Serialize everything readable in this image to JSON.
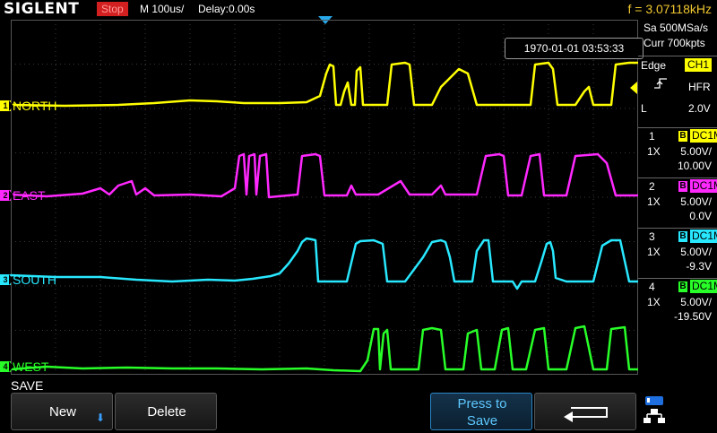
{
  "header": {
    "brand": "SIGLENT",
    "run_state": "Stop",
    "timebase": "M 100us/",
    "delay": "Delay:0.00s",
    "frequency": "f = 3.07118kHz"
  },
  "timestamp": "1970-01-01 03:53:33",
  "acquisition": {
    "sample_rate": "Sa 500MSa/s",
    "memory_depth": "Curr 700kpts"
  },
  "trigger": {
    "type": "Edge",
    "source": "CH1",
    "slope_icon": "rising-edge-icon",
    "coupling": "HFR",
    "level_label": "L",
    "level": "2.0V"
  },
  "channels": [
    {
      "num": "1",
      "bw": "B",
      "coupling": "DC1M",
      "probe": "1X",
      "scale": "5.00V/",
      "offset": "10.00V",
      "label": "NORTH",
      "color": "#ffff00"
    },
    {
      "num": "2",
      "bw": "B",
      "coupling": "DC1M",
      "probe": "1X",
      "scale": "5.00V/",
      "offset": "0.0V",
      "label": "EAST",
      "color": "#ff28ff"
    },
    {
      "num": "3",
      "bw": "B",
      "coupling": "DC1M",
      "probe": "1X",
      "scale": "5.00V/",
      "offset": "-9.3V",
      "label": "SOUTH",
      "color": "#28e8ff"
    },
    {
      "num": "4",
      "bw": "B",
      "coupling": "DC1M",
      "probe": "1X",
      "scale": "5.00V/",
      "offset": "-19.50V",
      "label": "WEST",
      "color": "#28ff28"
    }
  ],
  "menu": {
    "title": "SAVE",
    "new_label": "New",
    "delete_label": "Delete",
    "save_line1": "Press to",
    "save_line2": "Save",
    "back_icon": "return-arrow-icon",
    "storage_icon": "network-storage-icon"
  }
}
